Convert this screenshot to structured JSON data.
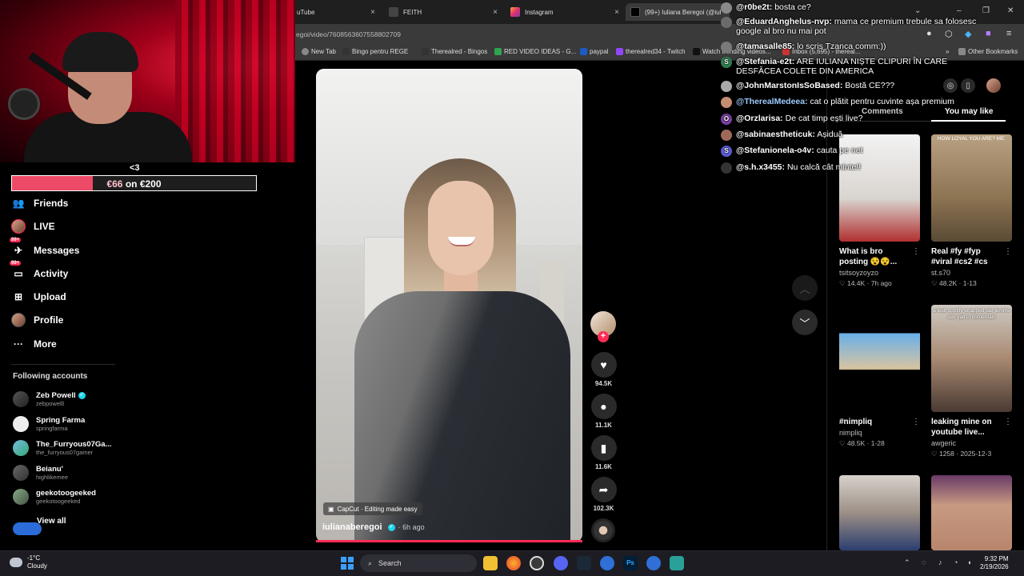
{
  "browser": {
    "tabs": [
      {
        "label": "uTube",
        "close": "×"
      },
      {
        "label": "FEITH",
        "close": "×"
      },
      {
        "label": "Instagram",
        "close": "×"
      },
      {
        "label": "(99+) Iuliana Beregoi (@iuliana",
        "close": "×"
      }
    ],
    "url": "egoi/video/7608563607558802709",
    "bookmarks": [
      "New Tab",
      "Bingo pentru REGE",
      "Therealred - Bingos",
      "RED VIDEO IDEAS - G...",
      "paypal",
      "therealred34 - Twitch",
      "Watch trending videos...",
      "Inbox (5,695) - thereal..."
    ],
    "other_bookmarks": "Other Bookmarks",
    "more_bookmarks": "»"
  },
  "goal": {
    "arrow": "<3",
    "current": "€66",
    "text": "on €200",
    "progress_fraction": 0.33,
    "fill_color": "#ec4a66"
  },
  "sidebar": {
    "items": [
      {
        "label": "Friends",
        "icon": "friends-icon"
      },
      {
        "label": "LIVE",
        "icon": "live-avatar"
      },
      {
        "label": "Messages",
        "icon": "messages-icon",
        "badge": "99+"
      },
      {
        "label": "Activity",
        "icon": "activity-icon",
        "badge": "99+"
      },
      {
        "label": "Upload",
        "icon": "upload-icon"
      },
      {
        "label": "Profile",
        "icon": "profile-avatar"
      },
      {
        "label": "More",
        "icon": "more-icon"
      }
    ],
    "following_heading": "Following accounts",
    "accounts": [
      {
        "name": "Zeb Powell",
        "handle": "zebpowelll",
        "verified": true
      },
      {
        "name": "Spring Farma",
        "handle": "springfarma",
        "verified": false
      },
      {
        "name": "The_Furryous07Ga...",
        "handle": "the_furryous07gamer",
        "verified": false
      },
      {
        "name": "Beianu'",
        "handle": "highlikemee",
        "verified": false
      },
      {
        "name": "geekotoogeeked",
        "handle": "geekotoogeeked",
        "verified": false
      }
    ],
    "view_all": "View all"
  },
  "video": {
    "capcut": "CapCut · Editing made easy",
    "author": "iulianaberegoi",
    "ago": "· 6h ago",
    "progress_fraction": 1.0
  },
  "actions": {
    "likes": "94.5K",
    "comments": "11.1K",
    "saves": "11.6K",
    "shares": "102.3K"
  },
  "right_panel": {
    "tab_comments": "Comments",
    "tab_like": "You may like",
    "cards": [
      {
        "title": "What is bro posting 😵😵...",
        "user": "tsitsoyzoyzo",
        "stats": "♡ 14.4K · 7h ago",
        "overlay": ""
      },
      {
        "title": "Real #fy #fyp #viral #cs2 #cs",
        "user": "st.s70",
        "stats": "♡ 48.2K · 1-13",
        "overlay": "HOW LOYAL YOU ARE? ME:"
      },
      {
        "title": "#nimpliq",
        "user": "nimpliq",
        "stats": "♡ 48.5K · 1-28",
        "overlay": ""
      },
      {
        "title": "leaking mine on youtube live...",
        "user": "awgeric",
        "stats": "♡ 1258 · 2025-12-3",
        "overlay": "a iesit spotify wrapped dar lemme see yall in comentarii"
      },
      {
        "title": "",
        "user": "",
        "stats": "",
        "overlay": ""
      },
      {
        "title": "",
        "user": "",
        "stats": "",
        "overlay": ""
      }
    ]
  },
  "chat": [
    {
      "user": "@r0be2t:",
      "msg": "bosta ce?",
      "color": "#8a8a8a"
    },
    {
      "user": "@EduardAnghelus-nvp:",
      "msg": "mama ce premium trebule sa folosesc google al bro nu mai pot",
      "color": "#6b6b6b"
    },
    {
      "user": "@tamasalle85:",
      "msg": "lo scris Tzanca comm:))",
      "color": "#7a7a7a"
    },
    {
      "user": "@Stefania-e2t:",
      "msg": "ARE IULIANA NIȘTE CLIPURI ÎN CARE DESFĂCEA COLETE DIN AMERICA",
      "color": "#2e7d4f",
      "letter": "S"
    },
    {
      "user": "@JohnMarstonIsSoBased:",
      "msg": "Bostă CE???",
      "color": "#aaaaaa"
    },
    {
      "user": "@TherealMedeea:",
      "msg": "cat o plătit pentru cuvinte așa premium",
      "color": "#c48c70"
    },
    {
      "user": "@Orzlarisa:",
      "msg": "De cat timp ești live?",
      "color": "#7b3fa0",
      "letter": "O"
    },
    {
      "user": "@sabinaestheticuk:",
      "msg": "Așiduă",
      "color": "#a06a5a"
    },
    {
      "user": "@Stefanionela-o4v:",
      "msg": "cauta pe net",
      "color": "#5b5bd6",
      "letter": "S"
    },
    {
      "user": "@s.h.x3455:",
      "msg": "Nu calcă cât minte!!",
      "color": "#333333"
    }
  ],
  "taskbar": {
    "temp": "-1°C",
    "weather": "Cloudy",
    "search": "Search",
    "time": "9:32 PM",
    "date": "2/19/2026"
  }
}
